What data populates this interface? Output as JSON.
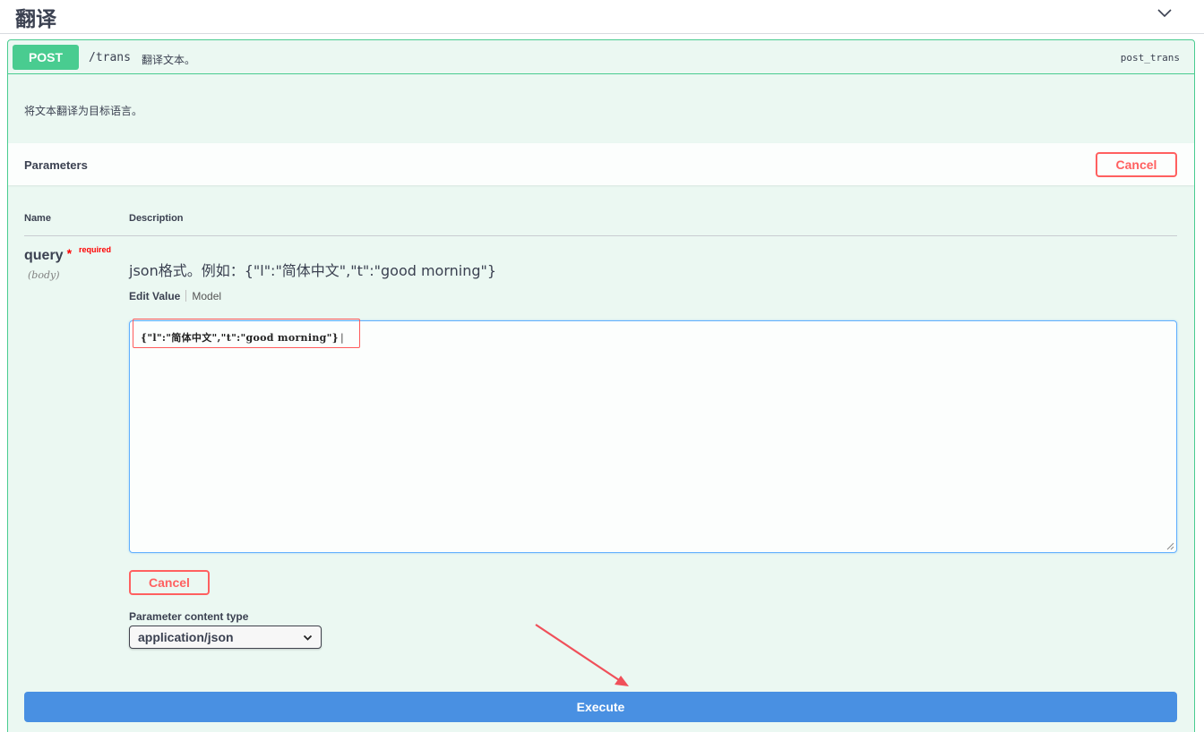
{
  "tag": {
    "title": "翻译",
    "collapse_icon": "chevron-down-icon"
  },
  "operation": {
    "method": "POST",
    "path": "/trans",
    "summary": "翻译文本。",
    "operation_id": "post_trans",
    "description": "将文本翻译为目标语言。",
    "method_color": "#49cc90",
    "block_background": "#ebf8f2"
  },
  "parameters": {
    "title": "Parameters",
    "cancel_label": "Cancel",
    "columns": {
      "name": "Name",
      "description": "Description"
    },
    "items": [
      {
        "name": "query",
        "required_star": "*",
        "required_label": "required",
        "location": "(body)",
        "description": "json格式。例如：{\"l\":\"简体中文\",\"t\":\"good morning\"}",
        "tabs": {
          "edit_value": "Edit Value",
          "model": "Model"
        },
        "value": "{\"l\":\"简体中文\",\"t\":\"good morning\"}"
      }
    ],
    "body_cancel_label": "Cancel",
    "content_type": {
      "label": "Parameter content type",
      "selected": "application/json"
    }
  },
  "execute": {
    "label": "Execute",
    "color": "#4990e2"
  },
  "colors": {
    "cancel": "#ff6060",
    "focus_border": "#61affe",
    "annotation_red": "#ff5b5b"
  }
}
